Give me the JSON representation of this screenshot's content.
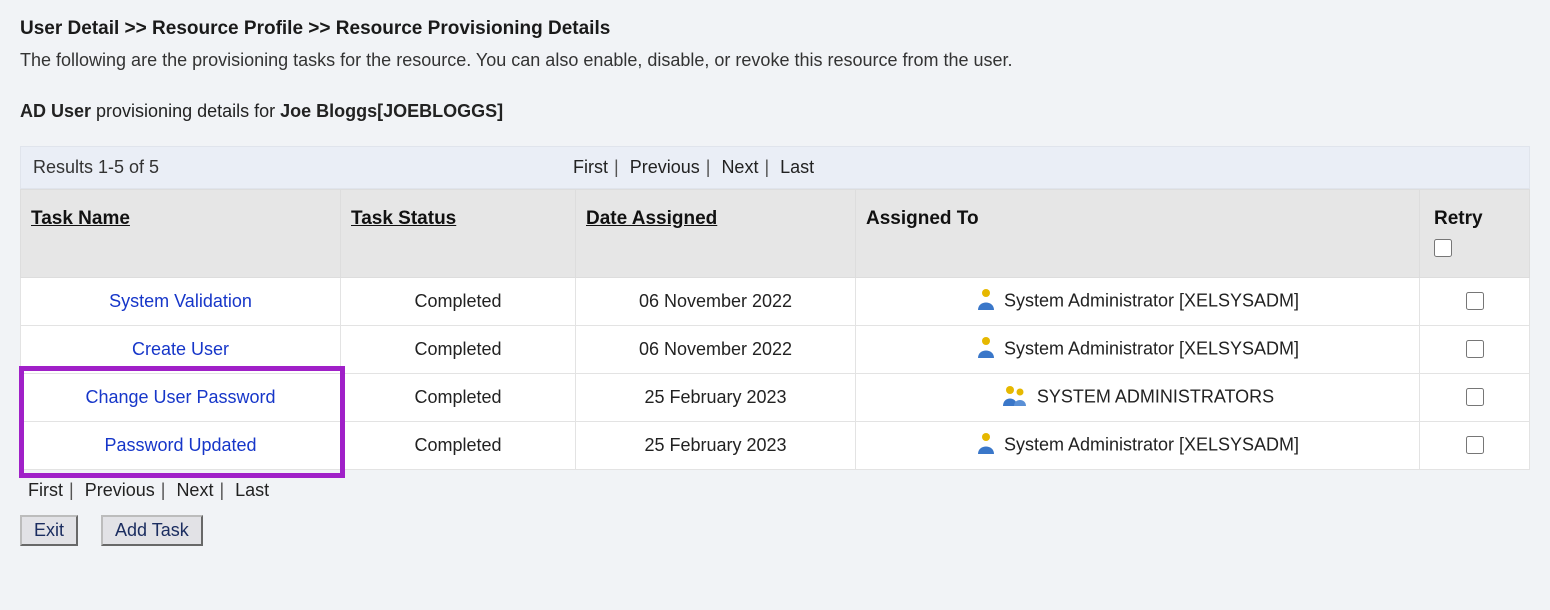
{
  "breadcrumb": {
    "parts": [
      "User Detail",
      "Resource Profile",
      "Resource Provisioning Details"
    ],
    "sep": " >> "
  },
  "description": "The following are the provisioning tasks for the resource. You can also enable, disable, or revoke this resource from the user.",
  "user_line": {
    "resource": "AD User",
    "mid": " provisioning details for ",
    "display": "Joe Bloggs[JOEBLOGGS]"
  },
  "results_label": "Results 1-5 of 5",
  "pager": {
    "first": "First",
    "prev": "Previous",
    "next": "Next",
    "last": "Last"
  },
  "columns": {
    "task_name": "Task Name",
    "task_status": "Task Status",
    "date_assigned": "Date Assigned",
    "assigned_to": "Assigned To",
    "retry": "Retry"
  },
  "rows": [
    {
      "task_name": "System Validation",
      "status": "Completed",
      "date": "06 November 2022",
      "assigned": "System Administrator [XELSYSADM]",
      "icon": "person"
    },
    {
      "task_name": "Create User",
      "status": "Completed",
      "date": "06 November 2022",
      "assigned": "System Administrator [XELSYSADM]",
      "icon": "person"
    },
    {
      "task_name": "Change User Password",
      "status": "Completed",
      "date": "25 February 2023",
      "assigned": "SYSTEM ADMINISTRATORS",
      "icon": "group"
    },
    {
      "task_name": "Password Updated",
      "status": "Completed",
      "date": "25 February 2023",
      "assigned": "System Administrator [XELSYSADM]",
      "icon": "person"
    }
  ],
  "buttons": {
    "exit": "Exit",
    "add_task": "Add Task"
  }
}
